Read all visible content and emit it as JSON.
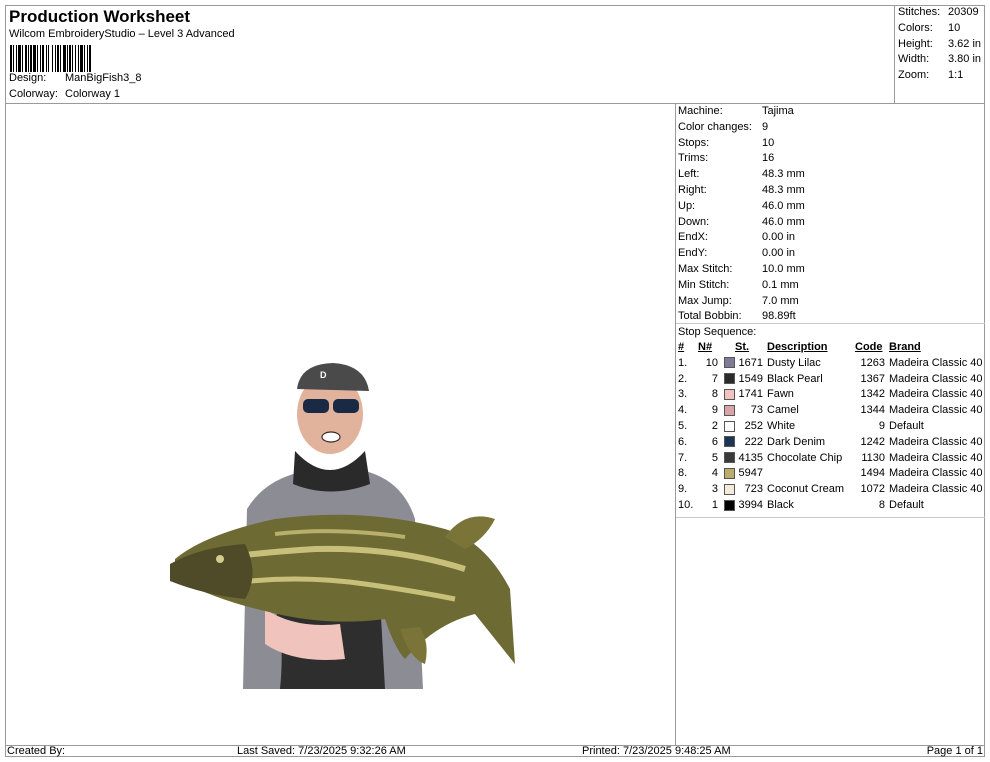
{
  "header": {
    "title": "Production Worksheet",
    "software": "Wilcom EmbroideryStudio – Level 3 Advanced",
    "design_label": "Design:",
    "design_value": "ManBigFish3_8",
    "colorway_label": "Colorway:",
    "colorway_value": "Colorway 1"
  },
  "summary": [
    {
      "label": "Stitches:",
      "value": "20309"
    },
    {
      "label": "Colors:",
      "value": "10"
    },
    {
      "label": "Height:",
      "value": "3.62 in"
    },
    {
      "label": "Width:",
      "value": "3.80 in"
    },
    {
      "label": "Zoom:",
      "value": "1:1"
    }
  ],
  "machine_info": [
    {
      "label": "Machine:",
      "value": "Tajima"
    },
    {
      "label": "Color changes:",
      "value": "9"
    },
    {
      "label": "Stops:",
      "value": "10"
    },
    {
      "label": "Trims:",
      "value": "16"
    },
    {
      "label": "Left:",
      "value": "48.3 mm"
    },
    {
      "label": "Right:",
      "value": "48.3 mm"
    },
    {
      "label": "Up:",
      "value": "46.0 mm"
    },
    {
      "label": "Down:",
      "value": "46.0 mm"
    },
    {
      "label": "EndX:",
      "value": "0.00 in"
    },
    {
      "label": "EndY:",
      "value": "0.00 in"
    },
    {
      "label": "Max Stitch:",
      "value": "10.0 mm"
    },
    {
      "label": "Min Stitch:",
      "value": "0.1 mm"
    },
    {
      "label": "Max Jump:",
      "value": "7.0 mm"
    },
    {
      "label": "Total Bobbin:",
      "value": "98.89ft"
    }
  ],
  "stop_sequence": {
    "label": "Stop Sequence:",
    "headers": {
      "idx": "#",
      "n": "N#",
      "st": "St.",
      "desc": "Description",
      "code": "Code",
      "brand": "Brand"
    },
    "rows": [
      {
        "idx": "1.",
        "n": "10",
        "color": "#7f7a96",
        "st": "1671",
        "desc": "Dusty Lilac",
        "code": "1263",
        "brand": "Madeira Classic 40"
      },
      {
        "idx": "2.",
        "n": "7",
        "color": "#2a2a2a",
        "st": "1549",
        "desc": "Black Pearl",
        "code": "1367",
        "brand": "Madeira Classic 40"
      },
      {
        "idx": "3.",
        "n": "8",
        "color": "#f3c3c0",
        "st": "1741",
        "desc": "Fawn",
        "code": "1342",
        "brand": "Madeira Classic 40"
      },
      {
        "idx": "4.",
        "n": "9",
        "color": "#d9a3a8",
        "st": "73",
        "desc": "Camel",
        "code": "1344",
        "brand": "Madeira Classic 40"
      },
      {
        "idx": "5.",
        "n": "2",
        "color": "#ffffff",
        "st": "252",
        "desc": "White",
        "code": "9",
        "brand": "Default"
      },
      {
        "idx": "6.",
        "n": "6",
        "color": "#1d3552",
        "st": "222",
        "desc": "Dark Denim",
        "code": "1242",
        "brand": "Madeira Classic 40"
      },
      {
        "idx": "7.",
        "n": "5",
        "color": "#3a3a3a",
        "st": "4135",
        "desc": "Chocolate Chip",
        "code": "1130",
        "brand": "Madeira Classic 40"
      },
      {
        "idx": "8.",
        "n": "4",
        "color": "#b9ad6b",
        "st": "5947",
        "desc": "",
        "code": "1494",
        "brand": "Madeira Classic 40"
      },
      {
        "idx": "9.",
        "n": "3",
        "color": "#f6e9dc",
        "st": "723",
        "desc": "Coconut Cream",
        "code": "1072",
        "brand": "Madeira Classic 40"
      },
      {
        "idx": "10.",
        "n": "1",
        "color": "#000000",
        "st": "3994",
        "desc": "Black",
        "code": "8",
        "brand": "Default"
      }
    ]
  },
  "footer": {
    "created": "Created By:",
    "saved": "Last Saved: 7/23/2025 9:32:26 AM",
    "printed": "Printed: 7/23/2025 9:48:25 AM",
    "page": "Page 1 of 1"
  }
}
